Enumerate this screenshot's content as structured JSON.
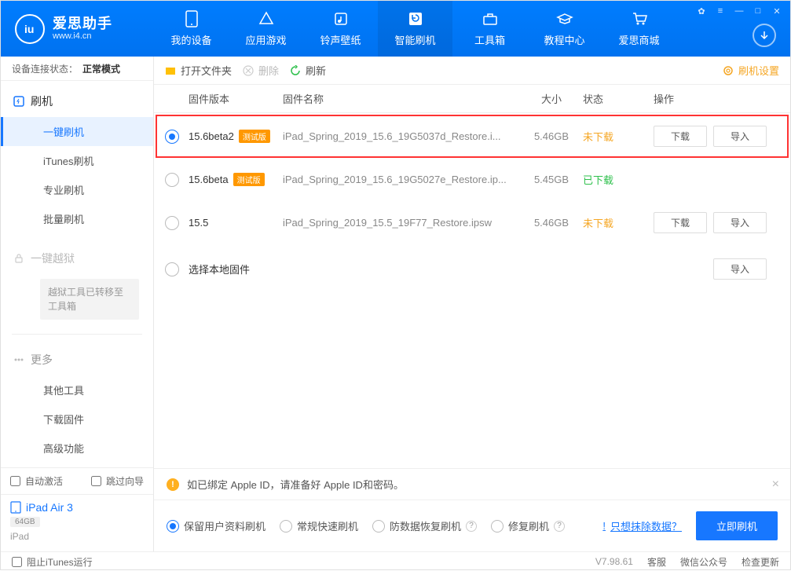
{
  "app": {
    "name": "爱思助手",
    "url": "www.i4.cn"
  },
  "window_controls": {
    "settings": "✿",
    "menu": "≡",
    "min": "—",
    "max": "□",
    "close": "✕"
  },
  "topnav": [
    {
      "label": "我的设备"
    },
    {
      "label": "应用游戏"
    },
    {
      "label": "铃声壁纸"
    },
    {
      "label": "智能刷机"
    },
    {
      "label": "工具箱"
    },
    {
      "label": "教程中心"
    },
    {
      "label": "爱思商城"
    }
  ],
  "sidebar": {
    "status_label": "设备连接状态：",
    "status_value": "正常模式",
    "sec1": {
      "head": "刷机",
      "items": [
        "一键刷机",
        "iTunes刷机",
        "专业刷机",
        "批量刷机"
      ]
    },
    "sec2": {
      "head": "一键越狱",
      "note": "越狱工具已转移至工具箱"
    },
    "sec3": {
      "head": "更多",
      "items": [
        "其他工具",
        "下载固件",
        "高级功能"
      ]
    },
    "auto_activate": "自动激活",
    "skip_guide": "跳过向导",
    "device": {
      "name": "iPad Air 3",
      "storage": "64GB",
      "type": "iPad"
    }
  },
  "toolbar": {
    "open_folder": "打开文件夹",
    "delete": "删除",
    "refresh": "刷新",
    "settings": "刷机设置"
  },
  "columns": {
    "version": "固件版本",
    "name": "固件名称",
    "size": "大小",
    "status": "状态",
    "operation": "操作"
  },
  "rows": [
    {
      "version": "15.6beta2",
      "beta": "测试版",
      "name": "iPad_Spring_2019_15.6_19G5037d_Restore.i...",
      "size": "5.46GB",
      "status": "未下载",
      "status_cls": "st-orange",
      "selected": true,
      "highlighted": true,
      "download": "下载",
      "import": "导入",
      "show_ops": true
    },
    {
      "version": "15.6beta",
      "beta": "测试版",
      "name": "iPad_Spring_2019_15.6_19G5027e_Restore.ip...",
      "size": "5.45GB",
      "status": "已下载",
      "status_cls": "st-green",
      "selected": false,
      "highlighted": false,
      "show_ops": false
    },
    {
      "version": "15.5",
      "beta": "",
      "name": "iPad_Spring_2019_15.5_19F77_Restore.ipsw",
      "size": "5.46GB",
      "status": "未下载",
      "status_cls": "st-orange",
      "selected": false,
      "highlighted": false,
      "download": "下载",
      "import": "导入",
      "show_ops": true
    }
  ],
  "local_row": {
    "label": "选择本地固件",
    "import": "导入"
  },
  "notice": "如已绑定 Apple ID，请准备好 Apple ID和密码。",
  "options": {
    "opt1": "保留用户资料刷机",
    "opt2": "常规快速刷机",
    "opt3": "防数据恢复刷机",
    "opt4": "修复刷机",
    "erase_link": "只想抹除数据？",
    "flash_now": "立即刷机"
  },
  "footer": {
    "block_itunes": "阻止iTunes运行",
    "version": "V7.98.61",
    "support": "客服",
    "wechat": "微信公众号",
    "check_update": "检查更新"
  }
}
